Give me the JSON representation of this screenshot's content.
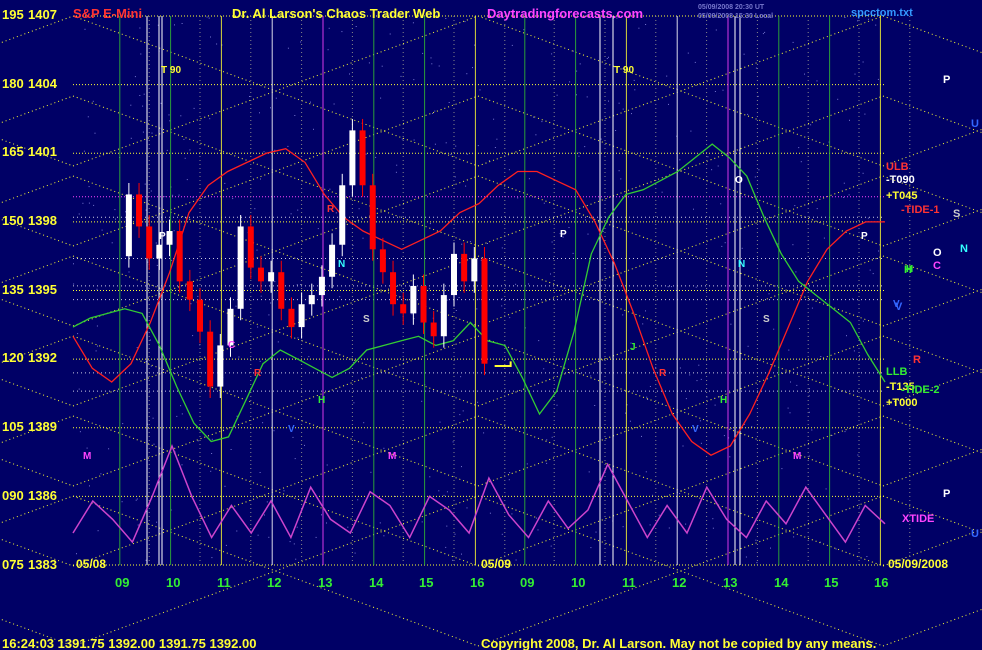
{
  "header": {
    "symbol": "S&P E-Mini",
    "title": "Dr. Al Larson's Chaos Trader Web",
    "site": "Daytradingforecasts.com",
    "timestamp1": "05/09/2008 20:30 UT",
    "timestamp2": "05/09/2008 15:30 Local",
    "file": "spcctom.txt"
  },
  "footer": {
    "quote": "16:24:03  1391.75 1392.00 1391.75 1392.00",
    "copyright": "Copyright 2008, Dr. Al Larson. May not be copied by any means."
  },
  "colors": {
    "background": "#000066",
    "price_up": "#ffffff",
    "price_down": "#ff0000",
    "tide_red": "#ff2020",
    "tide_green": "#33cc33",
    "xtide_magenta": "#cc44cc",
    "grid_yellow": "#ffff33",
    "grid_green": "#33bb33",
    "axis_white": "#ffffff"
  },
  "chart_data": {
    "type": "line",
    "y_left_labels": [
      "195",
      "180",
      "165",
      "150",
      "135",
      "120",
      "105",
      "090",
      "075"
    ],
    "y_right_labels": [
      "1407",
      "1404",
      "1401",
      "1398",
      "1395",
      "1392",
      "1389",
      "1386",
      "1383"
    ],
    "ylim": [
      1383,
      1407
    ],
    "x_tick_labels": [
      "09",
      "10",
      "11",
      "12",
      "13",
      "14",
      "15",
      "16",
      "09",
      "10",
      "11",
      "12",
      "13",
      "14",
      "15",
      "16"
    ],
    "date_labels": [
      "05/08",
      "05/09",
      "05/09/2008"
    ],
    "price_series": {
      "hours": [
        8.9,
        9.1,
        9.3,
        9.5,
        9.7,
        9.9,
        10.1,
        10.3,
        10.5,
        10.7,
        10.9,
        11.1,
        11.3,
        11.5,
        11.7,
        11.9,
        12.1,
        12.3,
        12.5,
        12.7,
        12.9,
        13.1,
        13.3,
        13.5,
        13.7,
        13.9,
        14.1,
        14.3,
        14.5,
        14.7,
        14.9,
        15.1,
        15.3,
        15.5,
        15.7,
        15.9,
        16.1
      ],
      "values": [
        1396.5,
        1399.2,
        1397.8,
        1396.4,
        1397.0,
        1397.6,
        1395.4,
        1394.6,
        1393.2,
        1390.8,
        1392.6,
        1394.2,
        1397.8,
        1396.0,
        1395.4,
        1395.8,
        1394.2,
        1393.4,
        1394.4,
        1394.8,
        1395.6,
        1397.0,
        1399.6,
        1402.0,
        1399.6,
        1396.8,
        1395.8,
        1394.4,
        1394.0,
        1395.2,
        1393.6,
        1393.0,
        1394.8,
        1396.6,
        1395.4,
        1396.4,
        1391.8
      ]
    },
    "tide_red": {
      "values": [
        1393.0,
        1391.6,
        1391.0,
        1391.8,
        1393.6,
        1395.8,
        1398.4,
        1399.6,
        1400.2,
        1400.6,
        1401.0,
        1401.2,
        1400.6,
        1399.2,
        1398.2,
        1397.6,
        1397.2,
        1396.8,
        1397.2,
        1397.6,
        1398.4,
        1398.8,
        1399.6,
        1400.2,
        1400.2,
        1399.8,
        1399.4,
        1398.0,
        1396.2,
        1394.0,
        1391.6,
        1389.6,
        1388.4,
        1387.8,
        1388.2,
        1389.6,
        1391.4,
        1393.4,
        1395.4,
        1396.8,
        1397.6,
        1398.0,
        1398.0
      ]
    },
    "tide_green": {
      "values": [
        1393.4,
        1393.8,
        1394.0,
        1394.2,
        1394.0,
        1392.6,
        1390.8,
        1389.2,
        1388.4,
        1388.6,
        1390.2,
        1391.8,
        1392.4,
        1392.0,
        1391.6,
        1391.2,
        1391.6,
        1392.4,
        1392.6,
        1392.8,
        1393.0,
        1392.6,
        1392.8,
        1393.6,
        1392.8,
        1392.6,
        1391.2,
        1389.6,
        1390.6,
        1393.2,
        1396.6,
        1398.2,
        1399.2,
        1399.4,
        1399.8,
        1400.2,
        1400.8,
        1401.4,
        1400.8,
        1400.0,
        1398.2,
        1396.6,
        1395.4,
        1394.8,
        1394.2,
        1393.6,
        1392.2,
        1391.0
      ]
    },
    "xtide": {
      "values": [
        1384.4,
        1385.8,
        1385.0,
        1384.0,
        1386.0,
        1388.2,
        1386.0,
        1384.2,
        1385.6,
        1384.4,
        1385.8,
        1384.2,
        1386.4,
        1385.0,
        1384.4,
        1386.2,
        1385.6,
        1384.2,
        1386.0,
        1385.4,
        1384.4,
        1386.8,
        1385.2,
        1384.2,
        1385.8,
        1384.6,
        1385.4,
        1387.4,
        1385.8,
        1384.2,
        1385.6,
        1384.4,
        1386.4,
        1385.0,
        1384.2,
        1385.8,
        1384.8,
        1386.4,
        1385.2,
        1384.0,
        1385.6,
        1384.8
      ]
    },
    "annotations": {
      "t90_labels": [
        "T 90",
        "T 90"
      ],
      "right_markers": [
        "ULB",
        "-T090",
        "+T045",
        "-TIDE-1",
        "LLB",
        "-T135",
        "+T000",
        "-TIDE-2",
        "XTIDE"
      ],
      "side_letters": [
        "P",
        "U",
        "S",
        "O",
        "N",
        "H",
        "C",
        "V",
        "R",
        "P",
        "U"
      ],
      "planet_letters": [
        "M",
        "M",
        "M",
        "R",
        "R",
        "R",
        "V",
        "V",
        "V",
        "H",
        "H",
        "H",
        "N",
        "N",
        "S",
        "S",
        "J",
        "P",
        "P",
        "P",
        "O",
        "C"
      ]
    }
  }
}
